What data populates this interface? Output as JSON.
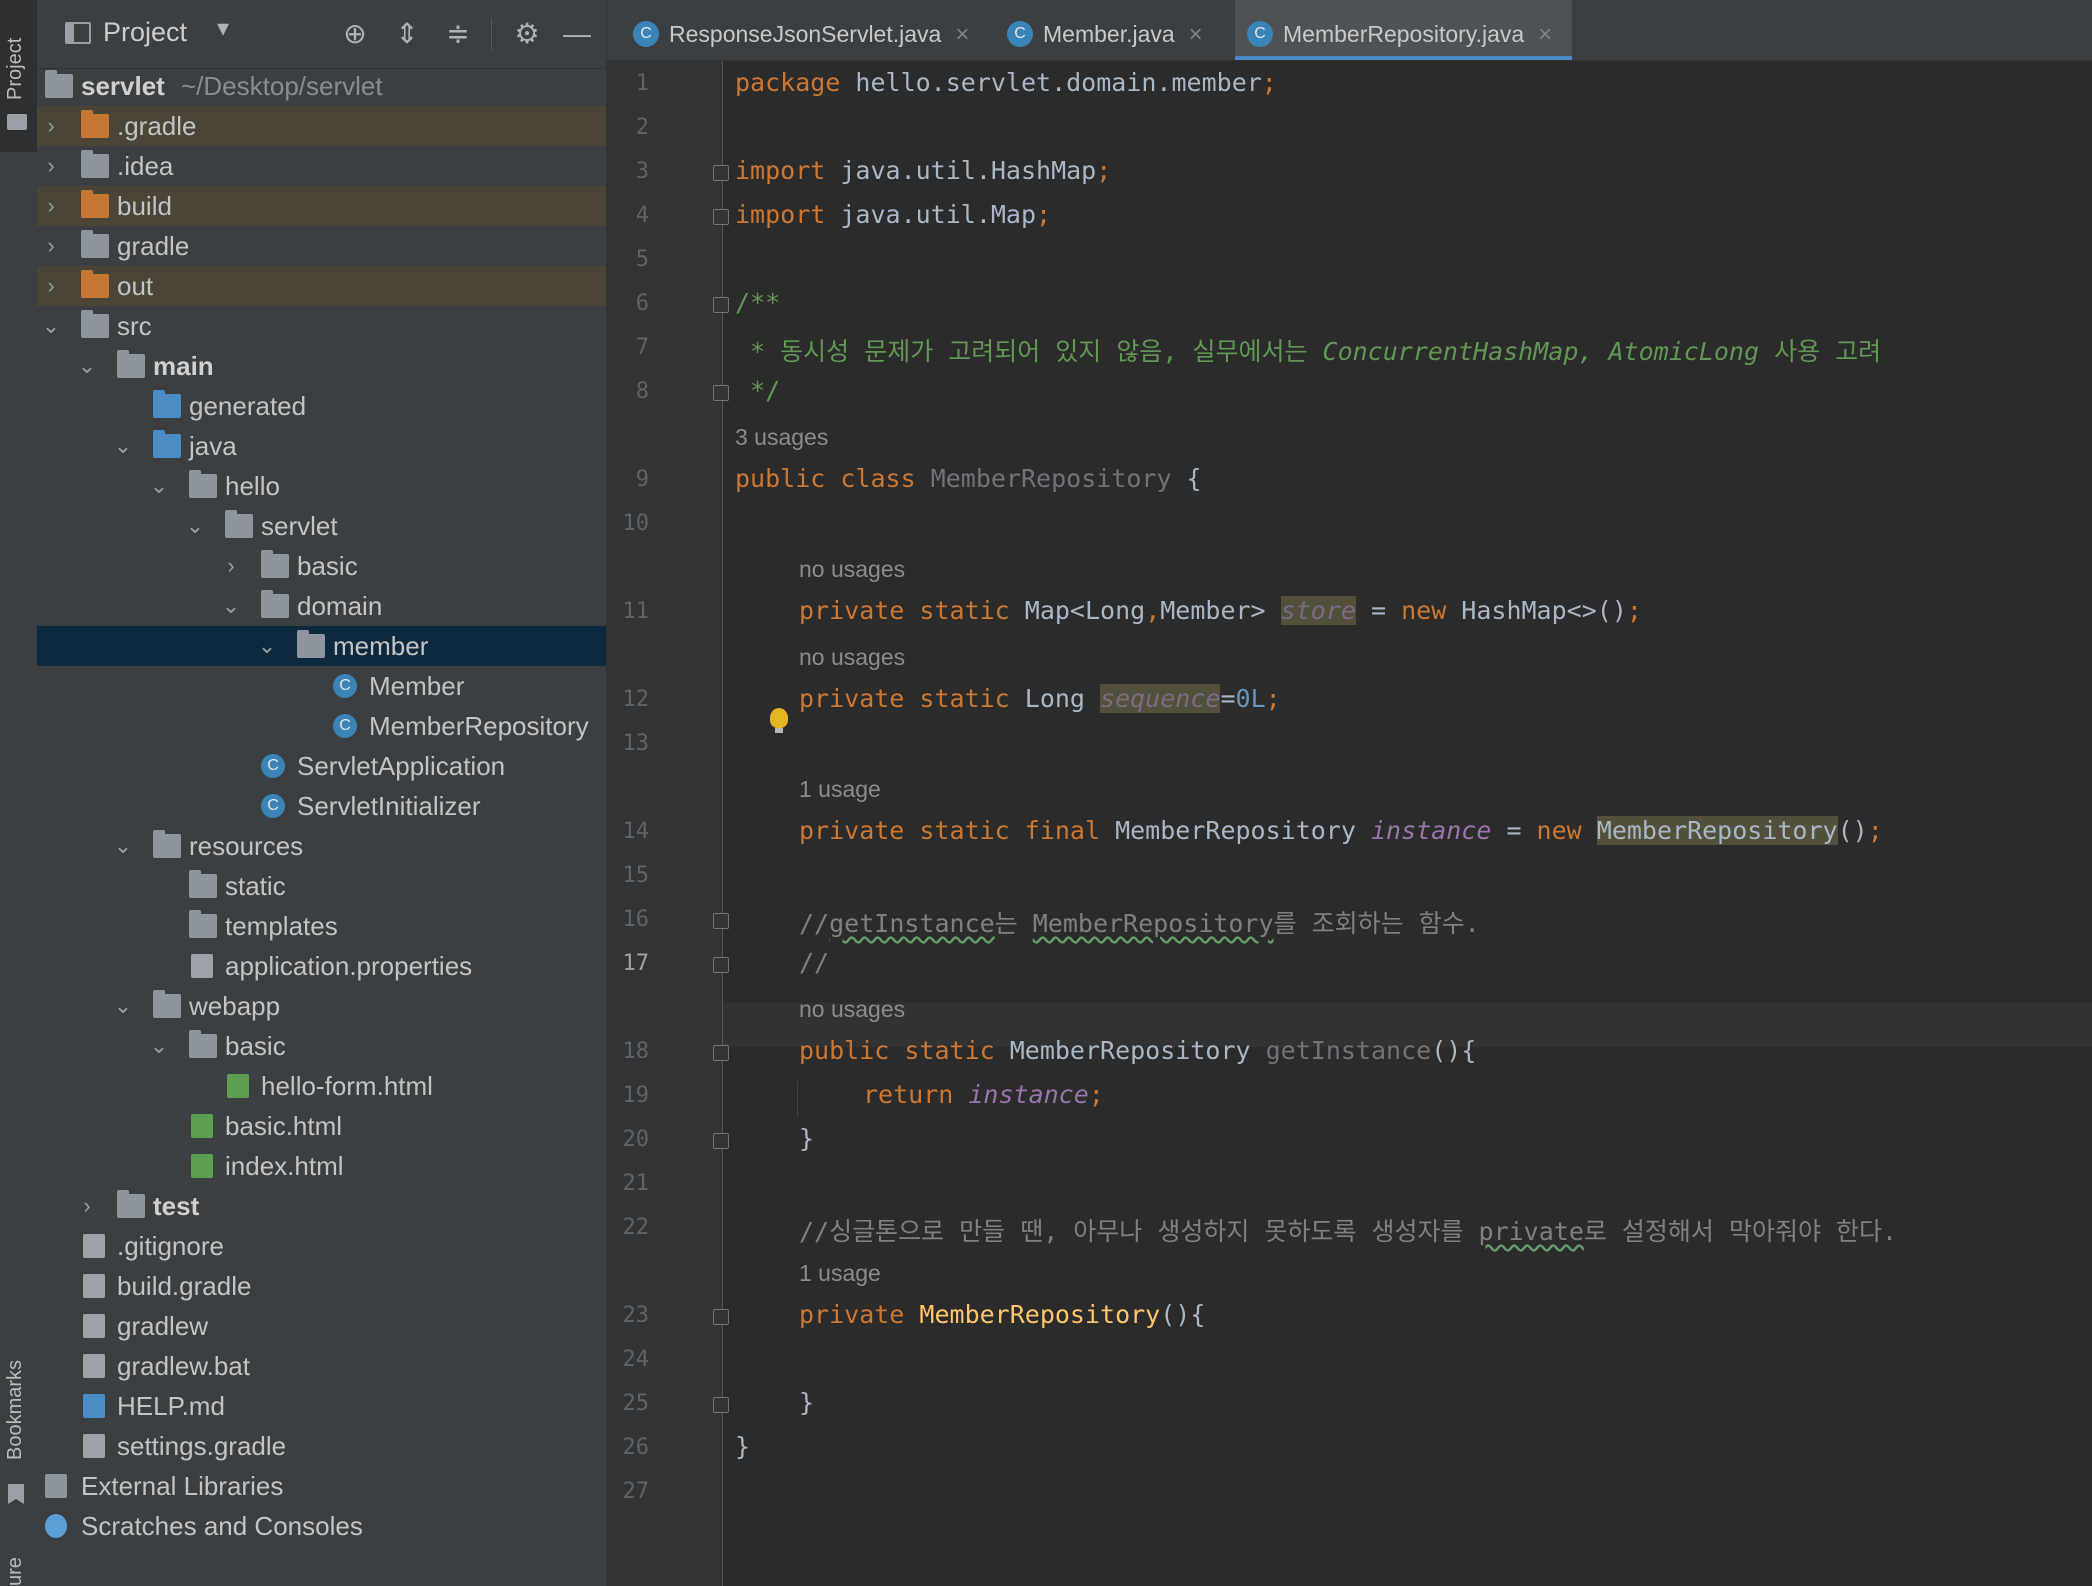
{
  "side_strip": {
    "project_label": "Project",
    "bookmarks_label": "Bookmarks",
    "structure_label": "ure"
  },
  "project_panel": {
    "title": "Project",
    "root": {
      "name": "servlet",
      "path": "~/Desktop/servlet"
    },
    "tree": [
      "servlet",
      ".gradle",
      ".idea",
      "build",
      "gradle",
      "out",
      "src",
      "main",
      "generated",
      "java",
      "hello",
      "servlet",
      "basic",
      "domain",
      "member",
      "Member",
      "MemberRepository",
      "ServletApplication",
      "ServletInitializer",
      "resources",
      "static",
      "templates",
      "application.properties",
      "webapp",
      "basic",
      "hello-form.html",
      "basic.html",
      "index.html",
      "test",
      ".gitignore",
      "build.gradle",
      "gradlew",
      "gradlew.bat",
      "HELP.md",
      "settings.gradle",
      "External Libraries",
      "Scratches and Consoles"
    ]
  },
  "tabs": [
    {
      "label": "ResponseJsonServlet.java",
      "icon": "class-icon"
    },
    {
      "label": "Member.java",
      "icon": "class-icon"
    },
    {
      "label": "MemberRepository.java",
      "icon": "class-icon",
      "active": true
    }
  ],
  "editor": {
    "current_line": "17",
    "line_numbers": [
      "1",
      "2",
      "3",
      "4",
      "5",
      "6",
      "7",
      "8",
      "9",
      "10",
      "11",
      "12",
      "13",
      "14",
      "15",
      "16",
      "17",
      "18",
      "19",
      "20",
      "21",
      "22",
      "23",
      "24",
      "25",
      "26",
      "27"
    ],
    "code": {
      "l1_kw": "package",
      "l1_rest": " hello.servlet.domain.member",
      "semi": ";",
      "import_kw": "import",
      "l3_rest": " java.util.HashMap",
      "l4_rest": " java.util.Map",
      "l6": "/**",
      "l7_a": " * 동시성 문제가 고려되어 있지 않음, 실무에서는 ",
      "l7_b": "ConcurrentHashMap, AtomicLong",
      "l7_c": " 사용 고려",
      "l8": " */",
      "l9_kw": "public class",
      "l9_name": " MemberRepository",
      "l9_brace": " {",
      "private_static": "private static",
      "l11_type": " Map<Long",
      "comma": ",",
      "l11_type2": "Member> ",
      "store": "store",
      "eq": " = ",
      "new_kw": "new",
      "l11_end": " HashMap<>()",
      "l12_type": " Long ",
      "sequence": "sequence",
      "l12_eq": "=",
      "l12_num": "0L",
      "l14_kw": "private static final",
      "l14_type": " MemberRepository ",
      "instance": "instance",
      "l14_ctor": "MemberRepository",
      "parens": "()",
      "l16_a": "//",
      "l16_b": "getInstance",
      "l16_c": "는 ",
      "l16_d": "MemberRepository",
      "l16_e": "를 조회하는 함수.",
      "l17": "//",
      "l18_kw": "public static",
      "l18_type": " MemberRepository ",
      "l18_fn": "getInstance",
      "l18_end": "(){",
      "l19_kw": "return",
      "close_brace": "}",
      "l22_a": "//싱글톤으로 만들 땐, 아무나 생성하지 못하도록 생성자를 ",
      "l22_b": "private",
      "l22_c": "로 설정해서 막아줘야 한다.",
      "l23_kw": "private",
      "l23_fn": " MemberRepository",
      "l23_end": "(){"
    },
    "inlays": {
      "class_usages": "3 usages",
      "store_usages": "no usages",
      "sequence_usages": "no usages",
      "instance_usages": "1 usage",
      "getinstance_usages": "no usages",
      "ctor_usages": "1 usage"
    }
  },
  "colors": {
    "keyword": "#cc7832",
    "doc_comment": "#629755",
    "field": "#9876aa",
    "number": "#6897bb",
    "function": "#ffc66d",
    "selection": "#0d293e",
    "excluded": "#4b4538"
  }
}
